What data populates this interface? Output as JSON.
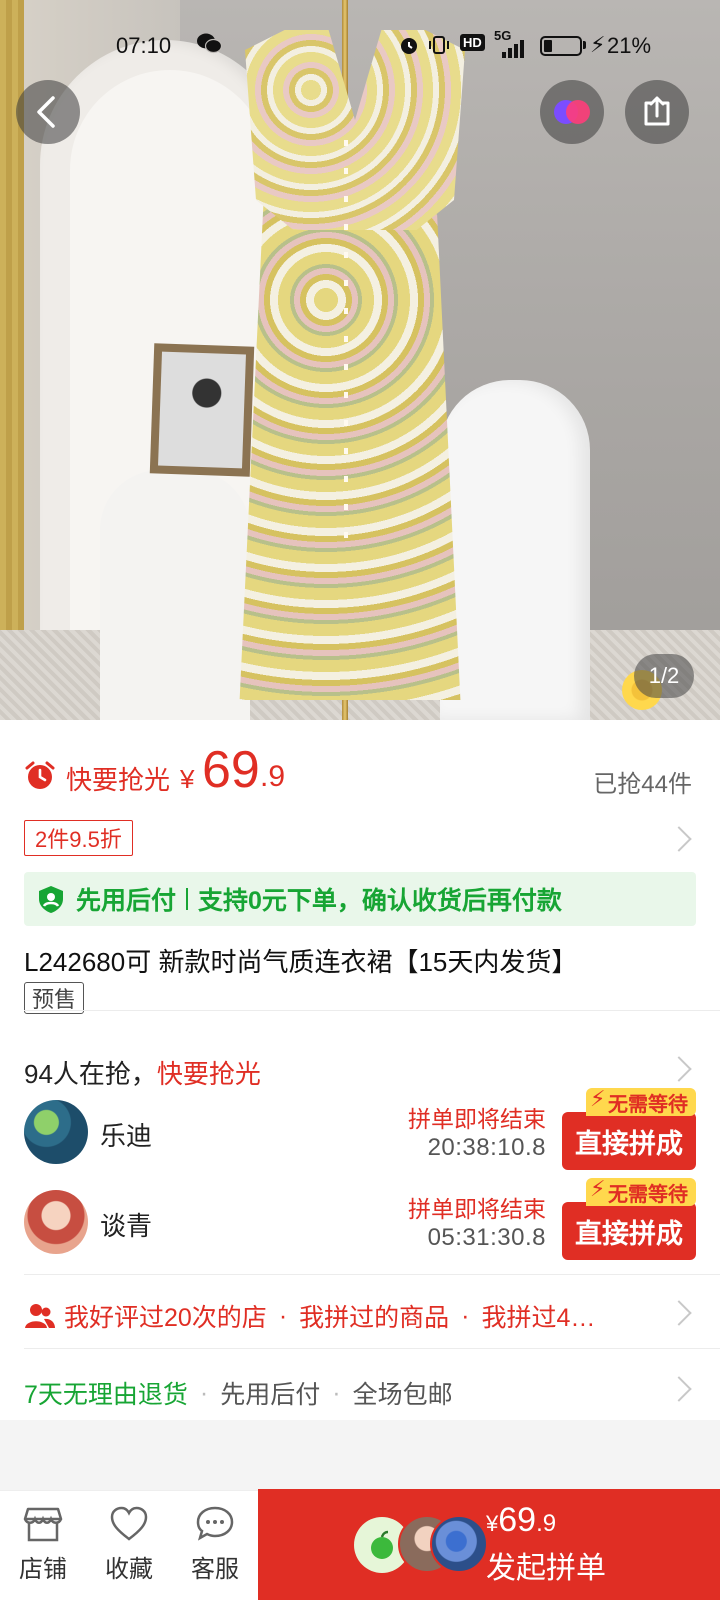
{
  "status_bar": {
    "time": "07:10",
    "hd": "HD",
    "network": "5G",
    "battery": "21%"
  },
  "gallery": {
    "counter": "1/2"
  },
  "price": {
    "urgency": "快要抢光",
    "currency": "¥",
    "integer": "69",
    "decimal": ".9",
    "sold": "已抢44件"
  },
  "discount_tag": "2件9.5折",
  "pay_after": {
    "label": "先用后付",
    "desc": "支持0元下单，确认收货后再付款"
  },
  "product": {
    "title": "L242680可 新款时尚气质连衣裙【15天内发货】",
    "presale": "预售"
  },
  "group_buy": {
    "count_text": "94人在抢，",
    "hot_text": "快要抢光",
    "groups": [
      {
        "name": "乐迪",
        "status": "拼单即将结束",
        "timer": "20:38:10.8",
        "tag": "无需等待",
        "button": "直接拼成"
      },
      {
        "name": "谈青",
        "status": "拼单即将结束",
        "timer": "05:31:30.8",
        "tag": "无需等待",
        "button": "直接拼成"
      }
    ]
  },
  "reviews": {
    "items": [
      "我好评过20次的店",
      "我拼过的商品",
      "我拼过4…"
    ]
  },
  "services": {
    "items": [
      "7天无理由退货",
      "先用后付",
      "全场包邮"
    ]
  },
  "bottom_bar": {
    "store": "店铺",
    "favorite": "收藏",
    "service": "客服",
    "cta_currency": "¥",
    "cta_int": "69",
    "cta_dec": ".9",
    "cta_label": "发起拼单"
  },
  "colors": {
    "accent_red": "#e02e24",
    "green": "#17a534",
    "tag_yellow": "#ffd84d"
  },
  "icons": [
    "back-arrow-icon",
    "mini-program-icon",
    "share-icon",
    "alarm-clock-icon",
    "pay-after-shield-icon",
    "people-icon",
    "store-icon",
    "heart-icon",
    "chat-icon",
    "apple-icon",
    "bolt-icon"
  ]
}
